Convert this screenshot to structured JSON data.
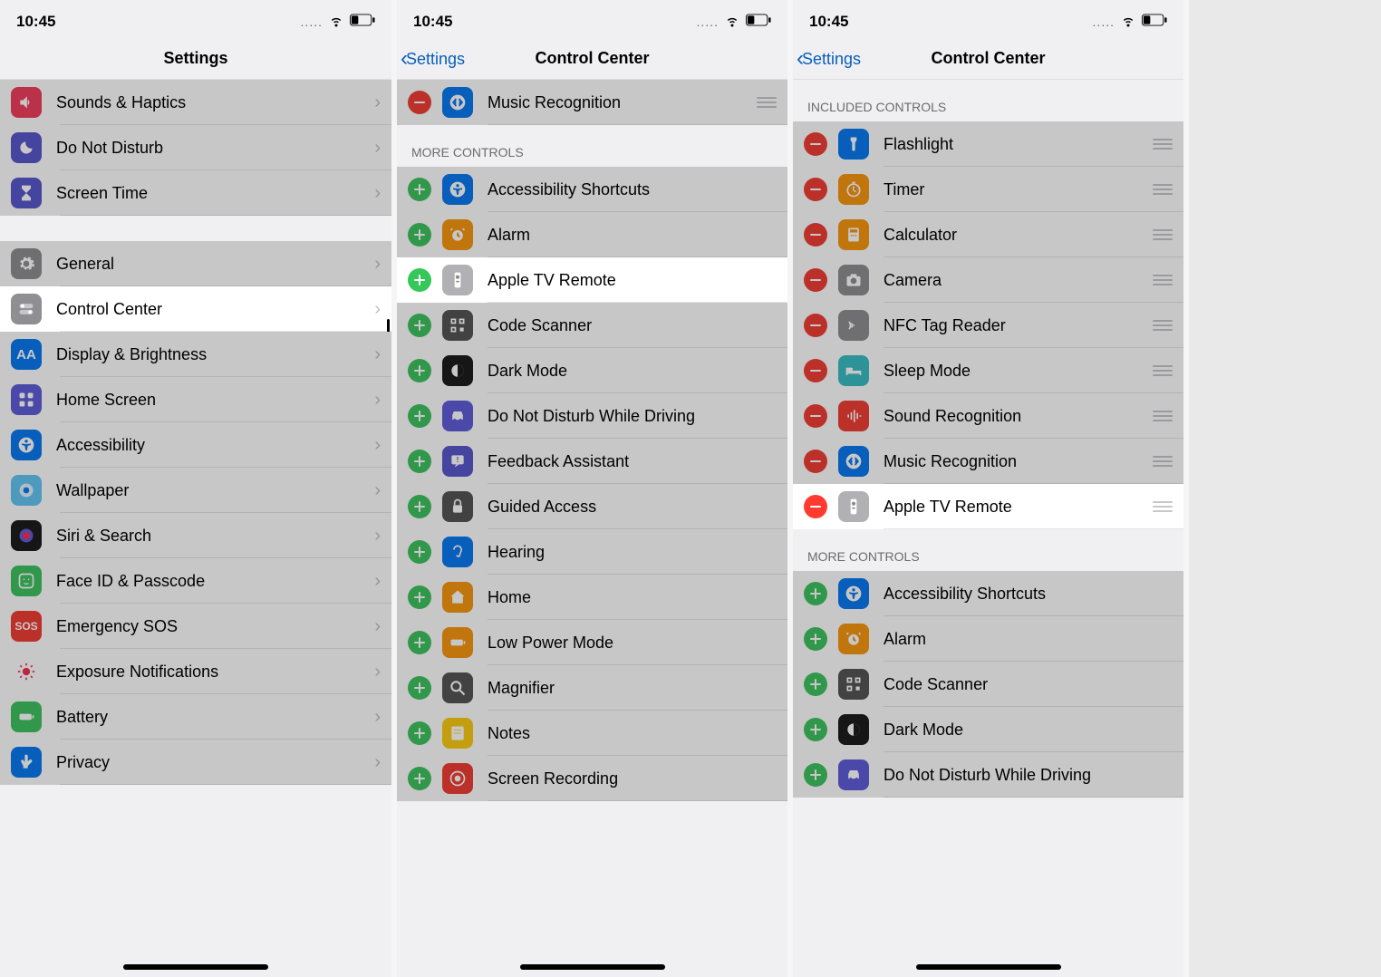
{
  "status": {
    "time": "10:45",
    "dots": ".....",
    "wifi": true,
    "battery": "low"
  },
  "panel1": {
    "title": "Settings",
    "items": [
      {
        "label": "Sounds & Haptics",
        "icon": "speaker",
        "color": "bg-pink"
      },
      {
        "label": "Do Not Disturb",
        "icon": "moon",
        "color": "bg-purple"
      },
      {
        "label": "Screen Time",
        "icon": "hourglass",
        "color": "bg-purple"
      }
    ],
    "items2": [
      {
        "label": "General",
        "icon": "gear",
        "color": "bg-grey"
      },
      {
        "label": "Control Center",
        "icon": "toggles",
        "color": "bg-grey",
        "highlight": true
      },
      {
        "label": "Display & Brightness",
        "icon": "aa",
        "color": "bg-blue"
      },
      {
        "label": "Home Screen",
        "icon": "grid",
        "color": "bg-indigo"
      },
      {
        "label": "Accessibility",
        "icon": "accessibility",
        "color": "bg-blue"
      },
      {
        "label": "Wallpaper",
        "icon": "wallpaper",
        "color": "bg-cyan"
      },
      {
        "label": "Siri & Search",
        "icon": "siri",
        "color": "bg-black"
      },
      {
        "label": "Face ID & Passcode",
        "icon": "faceid",
        "color": "bg-green"
      },
      {
        "label": "Emergency SOS",
        "icon": "sos",
        "color": "bg-red",
        "iconText": "SOS"
      },
      {
        "label": "Exposure Notifications",
        "icon": "exposure",
        "color": "",
        "iconColor": "#ff2d55"
      },
      {
        "label": "Battery",
        "icon": "battery",
        "color": "bg-green"
      },
      {
        "label": "Privacy",
        "icon": "hand",
        "color": "bg-blue"
      }
    ]
  },
  "panel2": {
    "back": "Settings",
    "title": "Control Center",
    "top_item": {
      "label": "Music Recognition",
      "icon": "shazam",
      "color": "bg-blue"
    },
    "section_more": "MORE CONTROLS",
    "more_items": [
      {
        "label": "Accessibility Shortcuts",
        "icon": "accessibility",
        "color": "bg-blue"
      },
      {
        "label": "Alarm",
        "icon": "alarm",
        "color": "bg-orange"
      },
      {
        "label": "Apple TV Remote",
        "icon": "remote",
        "color": "bg-lightgrey",
        "highlight": true
      },
      {
        "label": "Code Scanner",
        "icon": "qr",
        "color": "bg-darkgrey"
      },
      {
        "label": "Dark Mode",
        "icon": "darkmode",
        "color": "bg-black"
      },
      {
        "label": "Do Not Disturb While Driving",
        "icon": "car",
        "color": "bg-indigo"
      },
      {
        "label": "Feedback Assistant",
        "icon": "feedback",
        "color": "bg-purple"
      },
      {
        "label": "Guided Access",
        "icon": "lock",
        "color": "bg-darkgrey"
      },
      {
        "label": "Hearing",
        "icon": "ear",
        "color": "bg-blue"
      },
      {
        "label": "Home",
        "icon": "home",
        "color": "bg-orange"
      },
      {
        "label": "Low Power Mode",
        "icon": "battery",
        "color": "bg-orange"
      },
      {
        "label": "Magnifier",
        "icon": "magnifier",
        "color": "bg-darkgrey"
      },
      {
        "label": "Notes",
        "icon": "notes",
        "color": "bg-yellow"
      },
      {
        "label": "Screen Recording",
        "icon": "record",
        "color": "bg-red"
      }
    ]
  },
  "panel3": {
    "back": "Settings",
    "title": "Control Center",
    "section_included": "INCLUDED CONTROLS",
    "included_items": [
      {
        "label": "Flashlight",
        "icon": "flashlight",
        "color": "bg-blue"
      },
      {
        "label": "Timer",
        "icon": "timer",
        "color": "bg-orange"
      },
      {
        "label": "Calculator",
        "icon": "calculator",
        "color": "bg-orange"
      },
      {
        "label": "Camera",
        "icon": "camera",
        "color": "bg-grey"
      },
      {
        "label": "NFC Tag Reader",
        "icon": "nfc",
        "color": "bg-grey"
      },
      {
        "label": "Sleep Mode",
        "icon": "bed",
        "color": "bg-teal"
      },
      {
        "label": "Sound Recognition",
        "icon": "sound",
        "color": "bg-red"
      },
      {
        "label": "Music Recognition",
        "icon": "shazam",
        "color": "bg-blue"
      },
      {
        "label": "Apple TV Remote",
        "icon": "remote",
        "color": "bg-lightgrey",
        "highlight": true
      }
    ],
    "section_more": "MORE CONTROLS",
    "more_items": [
      {
        "label": "Accessibility Shortcuts",
        "icon": "accessibility",
        "color": "bg-blue"
      },
      {
        "label": "Alarm",
        "icon": "alarm",
        "color": "bg-orange"
      },
      {
        "label": "Code Scanner",
        "icon": "qr",
        "color": "bg-darkgrey"
      },
      {
        "label": "Dark Mode",
        "icon": "darkmode",
        "color": "bg-black"
      },
      {
        "label": "Do Not Disturb While Driving",
        "icon": "car",
        "color": "bg-indigo"
      }
    ]
  }
}
